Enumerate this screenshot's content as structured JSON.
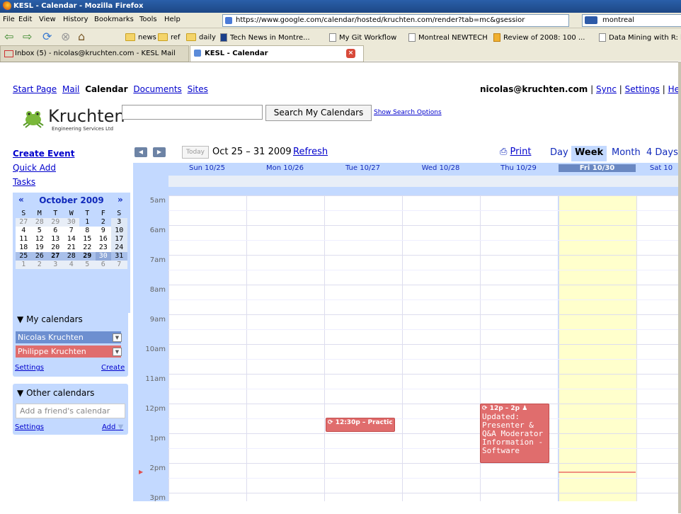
{
  "browser": {
    "title": "KESL - Calendar - Mozilla Firefox",
    "menu": [
      "File",
      "Edit",
      "View",
      "History",
      "Bookmarks",
      "Tools",
      "Help"
    ],
    "url": "https://www.google.com/calendar/hosted/kruchten.com/render?tab=mc&gsessior",
    "search_value": "montreal",
    "bookmarks": [
      "news",
      "ref",
      "daily",
      "Tech News in Montre...",
      "My Git Workflow",
      "Montreal NEWTECH",
      "Review of 2008: 100 ...",
      "Data Mining with R: l"
    ],
    "tabs": [
      {
        "label": "Inbox (5) - nicolas@kruchten.com - KESL Mail",
        "active": false
      },
      {
        "label": "KESL - Calendar",
        "active": true
      }
    ],
    "close_glyph": "×"
  },
  "app": {
    "topnav": [
      "Start Page",
      "Mail",
      "Calendar",
      "Documents",
      "Sites"
    ],
    "user_email": "nicolas@kruchten.com",
    "user_links": [
      "Sync",
      "Settings",
      "Hel"
    ],
    "separator": "|",
    "logo_name": "Kruchten",
    "logo_sub": "Engineering Services Ltd",
    "search_button": "Search My Calendars",
    "show_search_options": "Show Search Options",
    "left_links": [
      "Create Event",
      "Quick Add",
      "Tasks"
    ]
  },
  "minical": {
    "month": "October 2009",
    "prev": "«",
    "next": "»",
    "weekdays": [
      "S",
      "M",
      "T",
      "W",
      "T",
      "F",
      "S"
    ],
    "weeks": [
      [
        "27",
        "28",
        "29",
        "30",
        "1",
        "2",
        "3"
      ],
      [
        "4",
        "5",
        "6",
        "7",
        "8",
        "9",
        "10"
      ],
      [
        "11",
        "12",
        "13",
        "14",
        "15",
        "16",
        "17"
      ],
      [
        "18",
        "19",
        "20",
        "21",
        "22",
        "23",
        "24"
      ],
      [
        "25",
        "26",
        "27",
        "28",
        "29",
        "30",
        "31"
      ],
      [
        "1",
        "2",
        "3",
        "4",
        "5",
        "6",
        "7"
      ]
    ]
  },
  "my_calendars": {
    "title": "My calendars",
    "items": [
      {
        "name": "Nicolas Kruchten",
        "color": "#6d8fd0"
      },
      {
        "name": "Philippe Kruchten",
        "color": "#e06d6d"
      }
    ],
    "settings": "Settings",
    "create": "Create"
  },
  "other_calendars": {
    "title": "Other calendars",
    "placeholder": "Add a friend's calendar",
    "settings": "Settings",
    "add": "Add"
  },
  "toolbar": {
    "prev": "◀",
    "next": "▶",
    "today": "Today",
    "range": "Oct 25 – 31 2009",
    "refresh": "Refresh",
    "print": "Print",
    "views": [
      "Day",
      "Week",
      "Month",
      "4 Days"
    ],
    "active_view": "Week"
  },
  "week": {
    "days": [
      "Sun 10/25",
      "Mon 10/26",
      "Tue 10/27",
      "Wed 10/28",
      "Thu 10/29",
      "Fri 10/30",
      "Sat 10"
    ],
    "today_index": 5,
    "hours": [
      "5am",
      "6am",
      "7am",
      "8am",
      "9am",
      "10am",
      "11am",
      "12pm",
      "1pm",
      "2pm",
      "3pm"
    ]
  },
  "events": [
    {
      "time": "12:30p – Practic",
      "body": "",
      "day": 2,
      "color": "#e06d6d"
    },
    {
      "time": "12p – 2p",
      "body": "Updated: Presenter & Q&A Moderator Information - Software",
      "day": 4,
      "color": "#e06d6d"
    }
  ]
}
